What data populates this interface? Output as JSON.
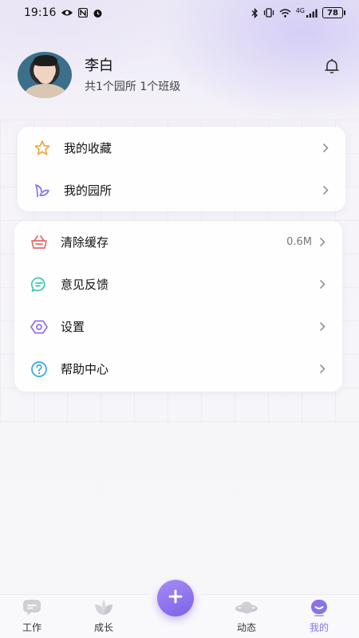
{
  "status_bar": {
    "time": "19:16",
    "network": "4G",
    "battery": "78"
  },
  "profile": {
    "name": "李白",
    "subtitle": "共1个园所 1个班级"
  },
  "menu_group_1": [
    {
      "label": "我的收藏",
      "icon": "star-icon"
    },
    {
      "label": "我的园所",
      "icon": "sprout-icon"
    }
  ],
  "menu_group_2": [
    {
      "label": "清除缓存",
      "value": "0.6M",
      "icon": "basket-icon"
    },
    {
      "label": "意见反馈",
      "icon": "chat-bubble-icon"
    },
    {
      "label": "设置",
      "icon": "hexagon-settings-icon"
    },
    {
      "label": "帮助中心",
      "icon": "help-circle-icon"
    }
  ],
  "tabbar": {
    "tabs": [
      {
        "label": "工作",
        "icon": "chat-card-icon"
      },
      {
        "label": "成长",
        "icon": "leaf-icon"
      },
      {
        "label": "动态",
        "icon": "planet-icon"
      },
      {
        "label": "我的",
        "icon": "smile-face-icon"
      }
    ],
    "fab_icon": "plus-icon"
  },
  "colors": {
    "accent": "#8b72e8",
    "star": "#f0a43a",
    "basket": "#e36a6a",
    "chat": "#3bc7b0",
    "help": "#3aa6e6"
  }
}
